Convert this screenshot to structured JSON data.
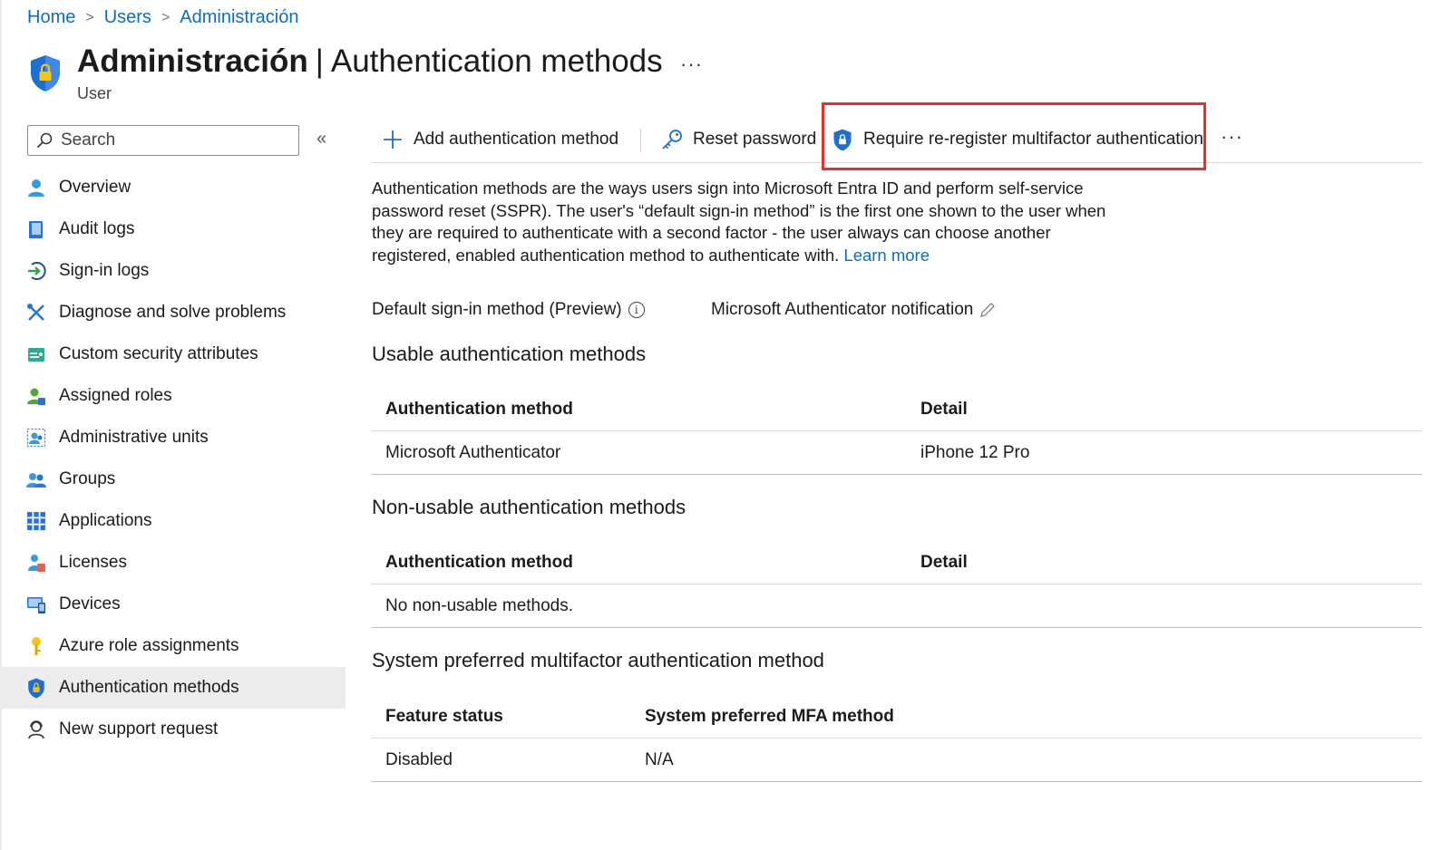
{
  "breadcrumb": [
    "Home",
    "Users",
    "Administración"
  ],
  "header": {
    "title_strong": "Administración",
    "title_separator": "|",
    "title_rest": "Authentication methods",
    "subtitle": "User",
    "more": "···"
  },
  "sidebar": {
    "search_placeholder": "Search",
    "collapse": "«",
    "items": [
      {
        "label": "Overview",
        "icon": "user-icon"
      },
      {
        "label": "Audit logs",
        "icon": "book-icon"
      },
      {
        "label": "Sign-in logs",
        "icon": "sign-in-icon"
      },
      {
        "label": "Diagnose and solve problems",
        "icon": "wrench-icon"
      },
      {
        "label": "Custom security attributes",
        "icon": "id-card-icon"
      },
      {
        "label": "Assigned roles",
        "icon": "user-role-icon"
      },
      {
        "label": "Administrative units",
        "icon": "admin-units-icon"
      },
      {
        "label": "Groups",
        "icon": "group-icon"
      },
      {
        "label": "Applications",
        "icon": "grid-icon"
      },
      {
        "label": "Licenses",
        "icon": "license-icon"
      },
      {
        "label": "Devices",
        "icon": "device-icon"
      },
      {
        "label": "Azure role assignments",
        "icon": "key-icon"
      },
      {
        "label": "Authentication methods",
        "icon": "shield-icon",
        "active": true
      },
      {
        "label": "New support request",
        "icon": "support-icon"
      }
    ]
  },
  "toolbar": {
    "add_label": "Add authentication method",
    "reset_label": "Reset password",
    "require_label": "Require re-register multifactor authentication",
    "more": "···"
  },
  "description": {
    "text": "Authentication methods are the ways users sign into Microsoft Entra ID and perform self-service password reset (SSPR). The user's “default sign-in method” is the first one shown to the user when they are required to authenticate with a second factor - the user always can choose another registered, enabled authentication method to authenticate with.",
    "link": "Learn more"
  },
  "default_method": {
    "label": "Default sign-in method (Preview)",
    "info": "i",
    "value": "Microsoft Authenticator notification"
  },
  "usable": {
    "title": "Usable authentication methods",
    "col1": "Authentication method",
    "col2": "Detail",
    "rows": [
      {
        "method": "Microsoft Authenticator",
        "detail": "iPhone 12 Pro"
      }
    ]
  },
  "non_usable": {
    "title": "Non-usable authentication methods",
    "col1": "Authentication method",
    "col2": "Detail",
    "empty": "No non-usable methods."
  },
  "system_preferred": {
    "title": "System preferred multifactor authentication method",
    "col1": "Feature status",
    "col2": "System preferred MFA method",
    "status": "Disabled",
    "method": "N/A"
  },
  "colors": {
    "link": "#0f6cbd",
    "highlight": "#e4322b",
    "icon_blue": "#1f6fd1"
  }
}
